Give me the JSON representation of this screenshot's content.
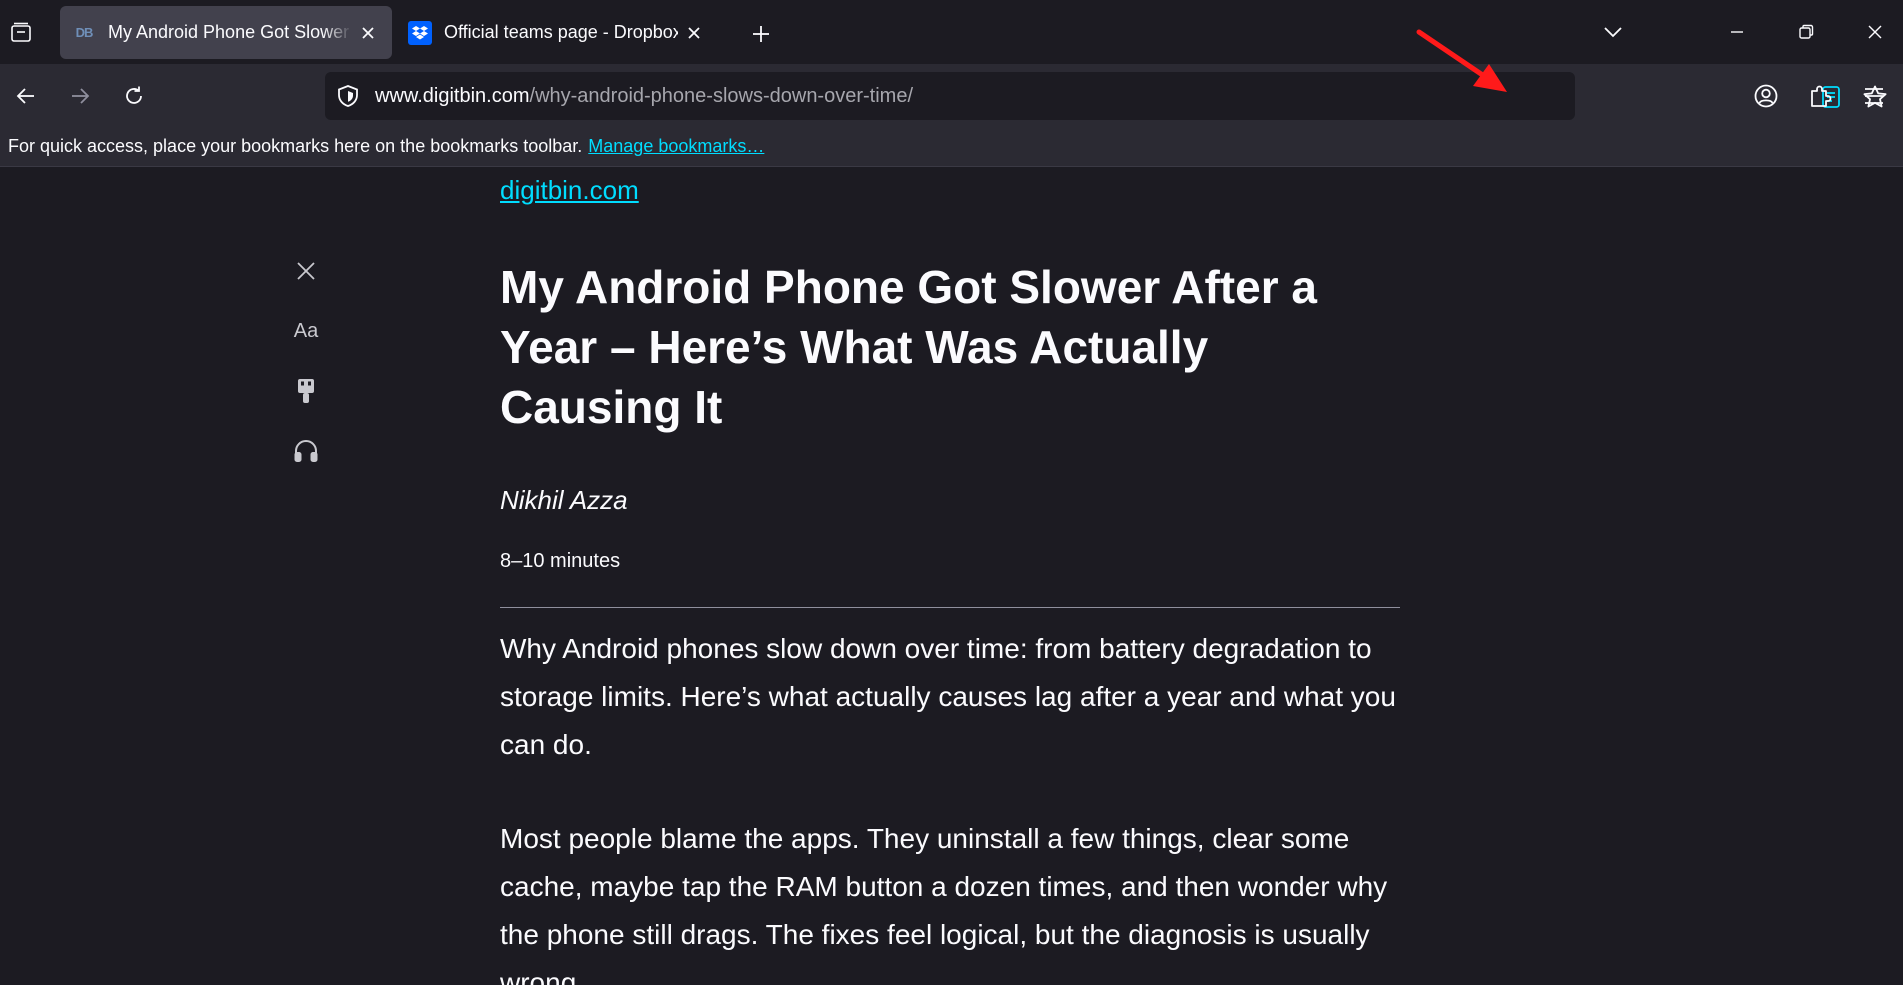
{
  "tabs": [
    {
      "title": "My Android Phone Got Slower After a Year – Here’s What Was Actually Causing It",
      "favicon": "digitbin-icon",
      "favicon_text": "DB",
      "active": true
    },
    {
      "title": "Official teams page - Dropbox",
      "favicon": "dropbox-icon",
      "active": false
    }
  ],
  "navbar": {
    "url_host": "www.digitbin.com",
    "url_path": "/why-android-phone-slows-down-over-time/"
  },
  "bookmarks_bar": {
    "hint": "For quick access, place your bookmarks here on the bookmarks toolbar.",
    "manage_link": "Manage bookmarks…"
  },
  "reader": {
    "toolbar": {
      "font_label": "Aa"
    },
    "domain": "digitbin.com",
    "headline": "My Android Phone Got Slower After a Year – Here’s What Was Actually Causing It",
    "byline": "Nikhil Azza",
    "read_time": "8–10 minutes",
    "paragraphs": [
      "Why Android phones slow down over time: from battery degradation to storage limits. Here’s what actually causes lag after a year and what you can do.",
      "Most people blame the apps. They uninstall a few things, clear some cache, maybe tap the RAM button a dozen times, and then wonder why the phone still drags. The fixes feel logical, but the diagnosis is usually wrong."
    ]
  },
  "colors": {
    "background": "#1c1b22",
    "toolbar": "#2b2a33",
    "active_tab": "#42414d",
    "accent_link": "#00ddff",
    "annotation_arrow": "#ff1a1a"
  }
}
